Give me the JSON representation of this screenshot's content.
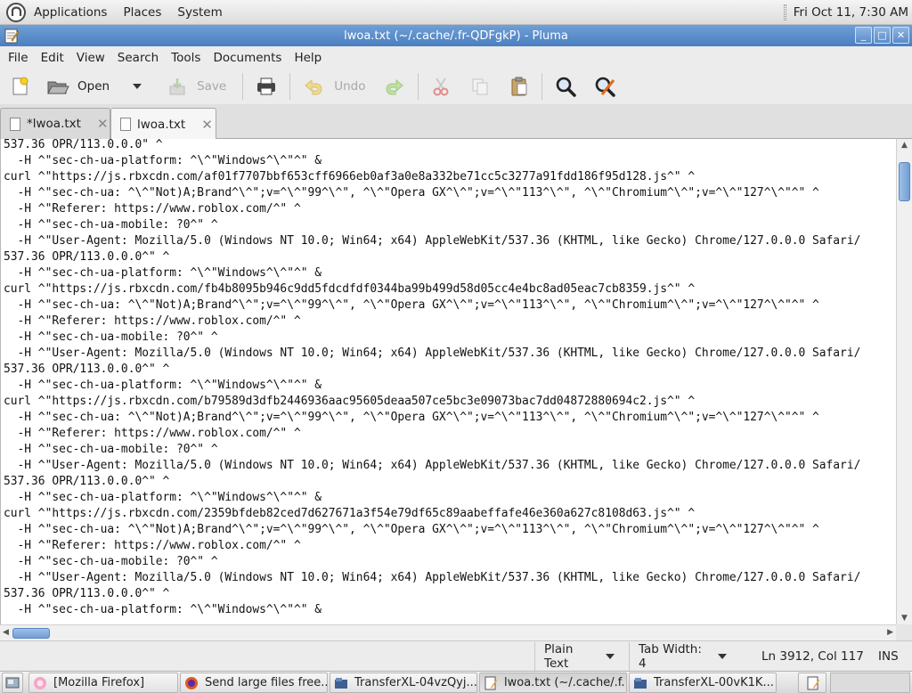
{
  "top_panel": {
    "menus": [
      "Applications",
      "Places",
      "System"
    ],
    "clock": "Fri Oct 11,  7:30 AM"
  },
  "window": {
    "title": "lwoa.txt (~/.cache/.fr-QDFgkP) - Pluma",
    "buttons": {
      "minimize": "_",
      "maximize": "□",
      "close": "✕"
    }
  },
  "menubar": [
    "File",
    "Edit",
    "View",
    "Search",
    "Tools",
    "Documents",
    "Help"
  ],
  "toolbar": {
    "open_label": "Open",
    "save_label": "Save",
    "undo_label": "Undo"
  },
  "tabs": [
    {
      "label": "*lwoa.txt",
      "active": false
    },
    {
      "label": "lwoa.txt",
      "active": true
    }
  ],
  "editor": {
    "lines": [
      "537.36 OPR/113.0.0.0\" ^",
      "  -H ^\"sec-ch-ua-platform: ^\\^\"Windows^\\^\"^\" &",
      "curl ^\"https://js.rbxcdn.com/af01f7707bbf653cff6966eb0af3a0e8a332be71cc5c3277a91fdd186f95d128.js^\" ^",
      "  -H ^\"sec-ch-ua: ^\\^\"Not)A;Brand^\\^\";v=^\\^\"99^\\^\", ^\\^\"Opera GX^\\^\";v=^\\^\"113^\\^\", ^\\^\"Chromium^\\^\";v=^\\^\"127^\\^\"^\" ^",
      "  -H ^\"Referer: https://www.roblox.com/^\" ^",
      "  -H ^\"sec-ch-ua-mobile: ?0^\" ^",
      "  -H ^\"User-Agent: Mozilla/5.0 (Windows NT 10.0; Win64; x64) AppleWebKit/537.36 (KHTML, like Gecko) Chrome/127.0.0.0 Safari/",
      "537.36 OPR/113.0.0.0^\" ^",
      "  -H ^\"sec-ch-ua-platform: ^\\^\"Windows^\\^\"^\" &",
      "curl ^\"https://js.rbxcdn.com/fb4b8095b946c9dd5fdcdfdf0344ba99b499d58d05cc4e4bc8ad05eac7cb8359.js^\" ^",
      "  -H ^\"sec-ch-ua: ^\\^\"Not)A;Brand^\\^\";v=^\\^\"99^\\^\", ^\\^\"Opera GX^\\^\";v=^\\^\"113^\\^\", ^\\^\"Chromium^\\^\";v=^\\^\"127^\\^\"^\" ^",
      "  -H ^\"Referer: https://www.roblox.com/^\" ^",
      "  -H ^\"sec-ch-ua-mobile: ?0^\" ^",
      "  -H ^\"User-Agent: Mozilla/5.0 (Windows NT 10.0; Win64; x64) AppleWebKit/537.36 (KHTML, like Gecko) Chrome/127.0.0.0 Safari/",
      "537.36 OPR/113.0.0.0^\" ^",
      "  -H ^\"sec-ch-ua-platform: ^\\^\"Windows^\\^\"^\" &",
      "curl ^\"https://js.rbxcdn.com/b79589d3dfb2446936aac95605deaa507ce5bc3e09073bac7dd04872880694c2.js^\" ^",
      "  -H ^\"sec-ch-ua: ^\\^\"Not)A;Brand^\\^\";v=^\\^\"99^\\^\", ^\\^\"Opera GX^\\^\";v=^\\^\"113^\\^\", ^\\^\"Chromium^\\^\";v=^\\^\"127^\\^\"^\" ^",
      "  -H ^\"Referer: https://www.roblox.com/^\" ^",
      "  -H ^\"sec-ch-ua-mobile: ?0^\" ^",
      "  -H ^\"User-Agent: Mozilla/5.0 (Windows NT 10.0; Win64; x64) AppleWebKit/537.36 (KHTML, like Gecko) Chrome/127.0.0.0 Safari/",
      "537.36 OPR/113.0.0.0^\" ^",
      "  -H ^\"sec-ch-ua-platform: ^\\^\"Windows^\\^\"^\" &",
      "curl ^\"https://js.rbxcdn.com/2359bfdeb82ced7d627671a3f54e79df65c89aabeffafe46e360a627c8108d63.js^\" ^",
      "  -H ^\"sec-ch-ua: ^\\^\"Not)A;Brand^\\^\";v=^\\^\"99^\\^\", ^\\^\"Opera GX^\\^\";v=^\\^\"113^\\^\", ^\\^\"Chromium^\\^\";v=^\\^\"127^\\^\"^\" ^",
      "  -H ^\"Referer: https://www.roblox.com/^\" ^",
      "  -H ^\"sec-ch-ua-mobile: ?0^\" ^",
      "  -H ^\"User-Agent: Mozilla/5.0 (Windows NT 10.0; Win64; x64) AppleWebKit/537.36 (KHTML, like Gecko) Chrome/127.0.0.0 Safari/",
      "537.36 OPR/113.0.0.0^\" ^",
      "  -H ^\"sec-ch-ua-platform: ^\\^\"Windows^\\^\"^\" &"
    ]
  },
  "statusbar": {
    "language": "Plain Text",
    "tab_width": "Tab Width: 4",
    "position": "Ln 3912, Col 117",
    "mode": "INS"
  },
  "taskbar": {
    "tasks": [
      {
        "label": "[Mozilla Firefox]",
        "icon": "firefox-icon"
      },
      {
        "label": "Send large files free...",
        "icon": "firefox-icon"
      },
      {
        "label": "TransferXL-04vzQyj...",
        "icon": "folder-icon"
      },
      {
        "label": "lwoa.txt (~/.cache/.f...",
        "icon": "text-editor-icon"
      },
      {
        "label": "TransferXL-00vK1K...",
        "icon": "folder-icon"
      }
    ]
  },
  "colors": {
    "title_bar": "#4b7fc0",
    "accent": "#6f9fd6"
  }
}
